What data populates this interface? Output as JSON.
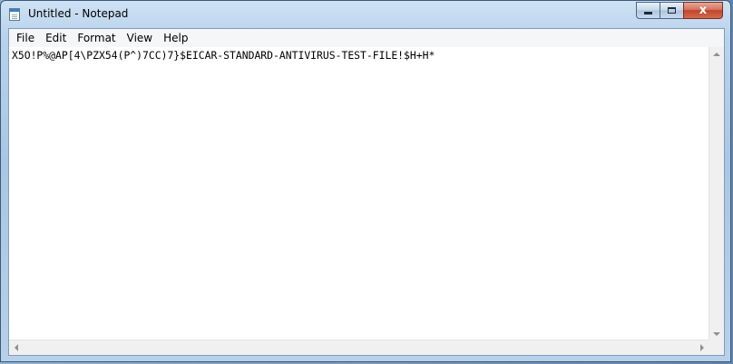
{
  "window": {
    "title": "Untitled - Notepad",
    "minimize_label": "",
    "maximize_label": "",
    "close_label": "x"
  },
  "menubar": {
    "items": [
      {
        "label": "File"
      },
      {
        "label": "Edit"
      },
      {
        "label": "Format"
      },
      {
        "label": "View"
      },
      {
        "label": "Help"
      }
    ]
  },
  "editor": {
    "content": "X5O!P%@AP[4\\PZX54(P^)7CC)7}$EICAR-STANDARD-ANTIVIRUS-TEST-FILE!$H+H*"
  },
  "icons": {
    "app": "notepad-icon",
    "minimize": "minimize-icon",
    "maximize": "maximize-icon",
    "close": "close-icon"
  },
  "colors": {
    "close_button": "#c4442a",
    "titlebar": "#b9d2eb"
  }
}
